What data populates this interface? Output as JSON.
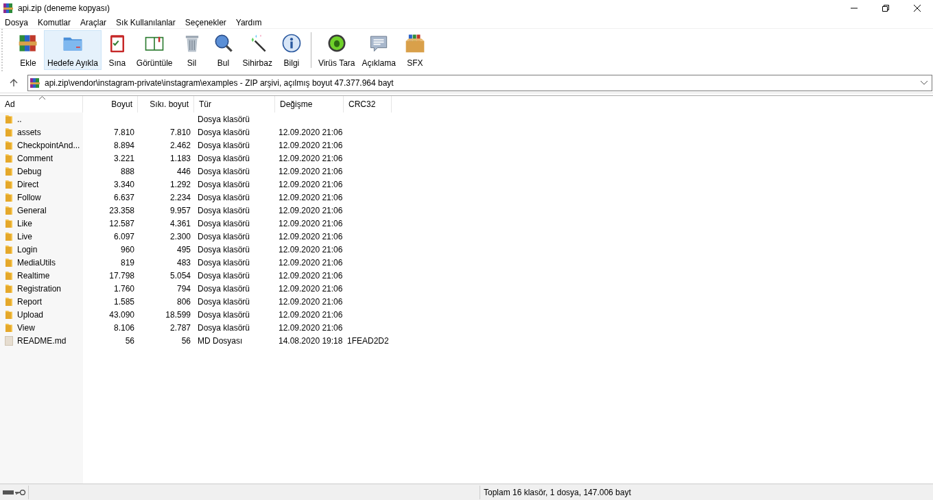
{
  "window": {
    "title": "api.zip (deneme kopyası)"
  },
  "menu": [
    "Dosya",
    "Komutlar",
    "Araçlar",
    "Sık Kullanılanlar",
    "Seçenekler",
    "Yardım"
  ],
  "toolbar": [
    [
      {
        "label": "Ekle",
        "kind": "add",
        "selected": false
      },
      {
        "label": "Hedefe Ayıkla",
        "kind": "extract",
        "selected": true
      },
      {
        "label": "Sına",
        "kind": "test",
        "selected": false
      },
      {
        "label": "Görüntüle",
        "kind": "view",
        "selected": false
      },
      {
        "label": "Sil",
        "kind": "delete",
        "selected": false
      },
      {
        "label": "Bul",
        "kind": "find",
        "selected": false
      },
      {
        "label": "Sihirbaz",
        "kind": "wizard",
        "selected": false
      },
      {
        "label": "Bilgi",
        "kind": "info",
        "selected": false
      }
    ],
    [
      {
        "label": "Virüs Tara",
        "kind": "virus",
        "selected": false
      },
      {
        "label": "Açıklama",
        "kind": "comment",
        "selected": false
      },
      {
        "label": "SFX",
        "kind": "sfx",
        "selected": false
      }
    ]
  ],
  "address": "api.zip\\vendor\\instagram-private\\instagram\\examples - ZIP arşivi, açılmış boyut 47.377.964 bayt",
  "table": {
    "columns": [
      {
        "label": "Ad",
        "sorted": true
      },
      {
        "label": "Boyut",
        "sorted": false
      },
      {
        "label": "Sıkı. boyut",
        "sorted": false
      },
      {
        "label": "Tür",
        "sorted": false
      },
      {
        "label": "Değişme",
        "sorted": false
      },
      {
        "label": "CRC32",
        "sorted": false
      }
    ],
    "rows": [
      {
        "kind": "folder",
        "cells": [
          "..",
          "",
          "",
          "Dosya klasörü",
          "",
          ""
        ]
      },
      {
        "kind": "folder",
        "cells": [
          "assets",
          "7.810",
          "7.810",
          "Dosya klasörü",
          "12.09.2020 21:06",
          ""
        ]
      },
      {
        "kind": "folder",
        "cells": [
          "CheckpointAnd...",
          "8.894",
          "2.462",
          "Dosya klasörü",
          "12.09.2020 21:06",
          ""
        ]
      },
      {
        "kind": "folder",
        "cells": [
          "Comment",
          "3.221",
          "1.183",
          "Dosya klasörü",
          "12.09.2020 21:06",
          ""
        ]
      },
      {
        "kind": "folder",
        "cells": [
          "Debug",
          "888",
          "446",
          "Dosya klasörü",
          "12.09.2020 21:06",
          ""
        ]
      },
      {
        "kind": "folder",
        "cells": [
          "Direct",
          "3.340",
          "1.292",
          "Dosya klasörü",
          "12.09.2020 21:06",
          ""
        ]
      },
      {
        "kind": "folder",
        "cells": [
          "Follow",
          "6.637",
          "2.234",
          "Dosya klasörü",
          "12.09.2020 21:06",
          ""
        ]
      },
      {
        "kind": "folder",
        "cells": [
          "General",
          "23.358",
          "9.957",
          "Dosya klasörü",
          "12.09.2020 21:06",
          ""
        ]
      },
      {
        "kind": "folder",
        "cells": [
          "Like",
          "12.587",
          "4.361",
          "Dosya klasörü",
          "12.09.2020 21:06",
          ""
        ]
      },
      {
        "kind": "folder",
        "cells": [
          "Live",
          "6.097",
          "2.300",
          "Dosya klasörü",
          "12.09.2020 21:06",
          ""
        ]
      },
      {
        "kind": "folder",
        "cells": [
          "Login",
          "960",
          "495",
          "Dosya klasörü",
          "12.09.2020 21:06",
          ""
        ]
      },
      {
        "kind": "folder",
        "cells": [
          "MediaUtils",
          "819",
          "483",
          "Dosya klasörü",
          "12.09.2020 21:06",
          ""
        ]
      },
      {
        "kind": "folder",
        "cells": [
          "Realtime",
          "17.798",
          "5.054",
          "Dosya klasörü",
          "12.09.2020 21:06",
          ""
        ]
      },
      {
        "kind": "folder",
        "cells": [
          "Registration",
          "1.760",
          "794",
          "Dosya klasörü",
          "12.09.2020 21:06",
          ""
        ]
      },
      {
        "kind": "folder",
        "cells": [
          "Report",
          "1.585",
          "806",
          "Dosya klasörü",
          "12.09.2020 21:06",
          ""
        ]
      },
      {
        "kind": "folder",
        "cells": [
          "Upload",
          "43.090",
          "18.599",
          "Dosya klasörü",
          "12.09.2020 21:06",
          ""
        ]
      },
      {
        "kind": "folder",
        "cells": [
          "View",
          "8.106",
          "2.787",
          "Dosya klasörü",
          "12.09.2020 21:06",
          ""
        ]
      },
      {
        "kind": "file",
        "cells": [
          "README.md",
          "56",
          "56",
          "MD Dosyası",
          "14.08.2020 19:18",
          "1FEAD2D2"
        ]
      }
    ]
  },
  "status_bar": {
    "summary": "Toplam 16 klasör, 1 dosya, 147.006 bayt"
  }
}
